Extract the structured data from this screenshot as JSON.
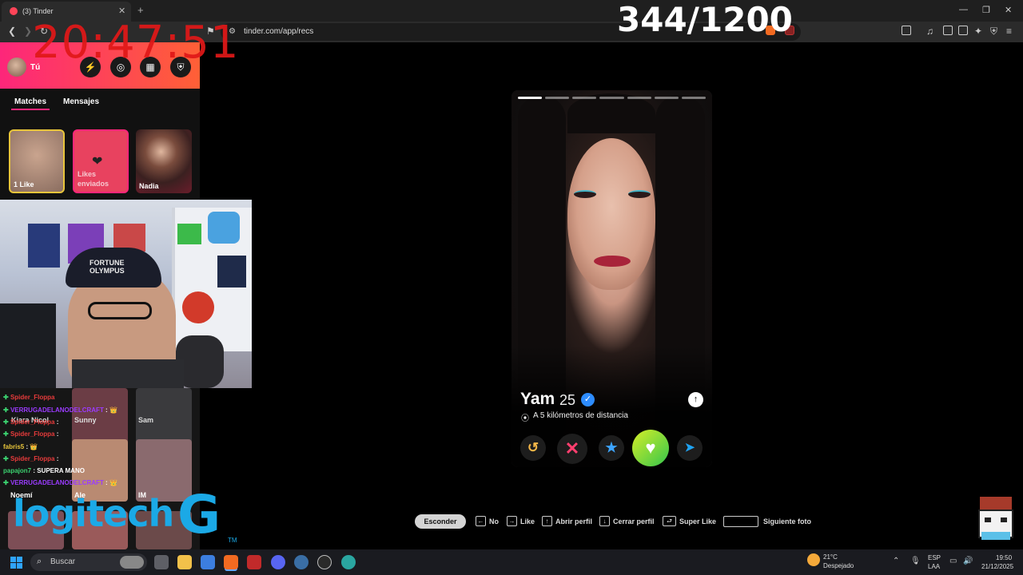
{
  "browser": {
    "tab_title": "(3) Tinder",
    "tab_close": "✕",
    "new_tab": "+",
    "url": "tinder.com/app/recs",
    "window_controls": [
      "—",
      "❐",
      "✕"
    ]
  },
  "overlay": {
    "clock": "20:47:51",
    "counter": "344/1200"
  },
  "sidebar": {
    "me_label": "Tú",
    "tabs": [
      "Matches",
      "Mensajes"
    ],
    "match_cards": [
      {
        "label": "1 Like"
      },
      {
        "label": "Likes enviados"
      },
      {
        "label": "Nadia"
      }
    ],
    "thumbs": [
      "Kiara Nicol",
      "Sunny",
      "Sam",
      "Noemí",
      "Ale",
      "IM"
    ]
  },
  "chat": [
    {
      "user": "Spider_Floppa",
      "msg": "",
      "color": "#e83b3b"
    },
    {
      "user": "VERRUGADELANODELCRAFT",
      "msg": " : 👑",
      "color": "#9b3bff"
    },
    {
      "user": "Spider_Floppa",
      "msg": " :",
      "color": "#e83b3b"
    },
    {
      "user": "Spider_Floppa",
      "msg": " :",
      "color": "#e83b3b"
    },
    {
      "user": "fabris5",
      "msg": " : 👑",
      "color": "#e8c53b"
    },
    {
      "user": "Spider_Floppa",
      "msg": " :",
      "color": "#e83b3b"
    },
    {
      "user": "papajon7",
      "msg": " : SUPERA MANO",
      "color": "#3bd16f"
    },
    {
      "user": "VERRUGADELANODELCRAFT",
      "msg": " : 👑",
      "color": "#9b3bff"
    }
  ],
  "sponsor": {
    "brand": "logitech",
    "g": "G",
    "tm": "TM"
  },
  "profile": {
    "name": "Yam",
    "age": "25",
    "distance": "A 5 kilómetros de distancia",
    "photo_count": 7,
    "active_photo": 1
  },
  "hints": {
    "hide": "Esconder",
    "items": [
      {
        "key": "←",
        "label": "No"
      },
      {
        "key": "→",
        "label": "Like"
      },
      {
        "key": "↑",
        "label": "Abrir perfil"
      },
      {
        "key": "↓",
        "label": "Cerrar perfil"
      },
      {
        "key": "⮐",
        "label": "Super Like"
      },
      {
        "key": "",
        "label": "Siguiente foto"
      }
    ]
  },
  "taskbar": {
    "search_placeholder": "Buscar",
    "temperature": "21°C",
    "condition": "Despejado",
    "lang1": "ESP",
    "lang2": "LAA",
    "time": "19:50",
    "date": "21/12/2025"
  },
  "colors": {
    "tinder_gradient_start": "#fd267a",
    "tinder_gradient_end": "#ff6036",
    "clock_red": "#e01818",
    "logitech_blue": "#1ba9e6",
    "like_green": "#34c64c"
  }
}
